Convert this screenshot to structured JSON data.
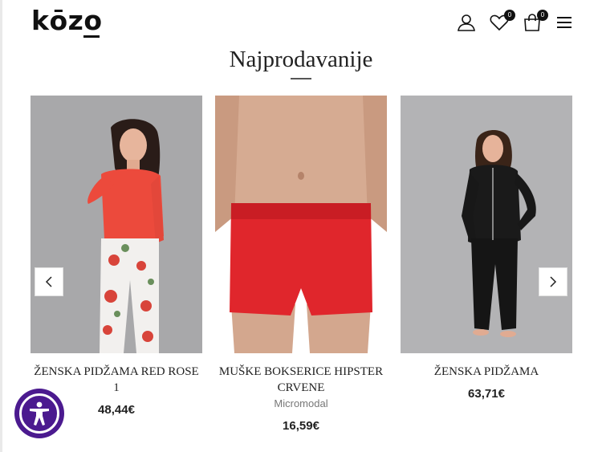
{
  "header": {
    "logo": "kōzo",
    "wishlist_count": "0",
    "cart_count": "0"
  },
  "section": {
    "title": "Najprodavanije"
  },
  "products": [
    {
      "name": "ŽENSKA PIDŽAMA RED ROSE 1",
      "subtitle": "",
      "price": "48,44€"
    },
    {
      "name": "MUŠKE BOKSERICE HIPSTER CRVENE",
      "subtitle": "Micromodal",
      "price": "16,59€"
    },
    {
      "name": "ŽENSKA PIDŽAMA",
      "subtitle": "",
      "price": "63,71€"
    }
  ],
  "icons": {
    "account": "user-icon",
    "wishlist": "heart-icon",
    "cart": "shopping-bag-icon",
    "menu": "hamburger-menu-icon",
    "prev": "chevron-left-icon",
    "next": "chevron-right-icon",
    "accessibility": "accessibility-icon"
  },
  "colors": {
    "accessibility_button": "#4b1a8f",
    "product_red": "#e0262c",
    "pajama_top": "#ec4a3c"
  }
}
